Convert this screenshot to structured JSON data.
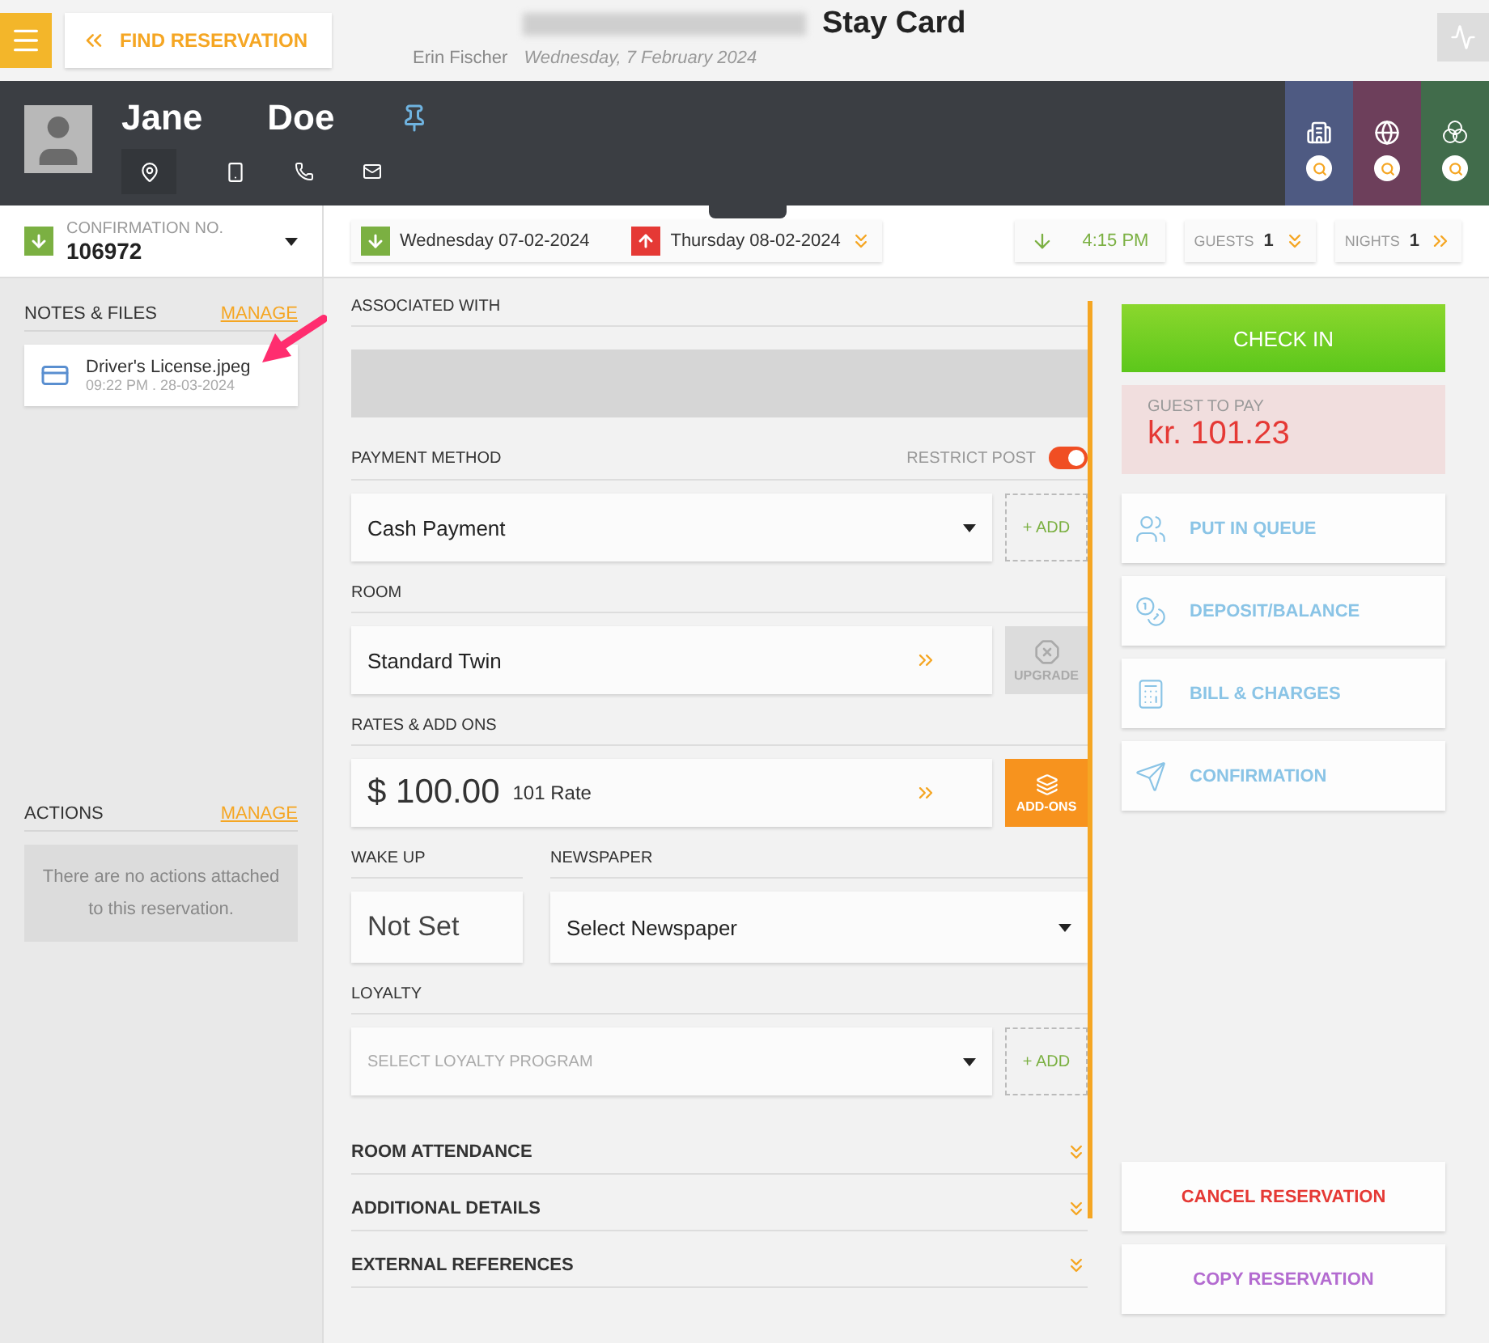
{
  "topbar": {
    "back_label": "FIND RESERVATION",
    "title": "Stay Card",
    "user": "Erin Fischer",
    "date": "Wednesday, 7 February 2024"
  },
  "guest": {
    "first_name": "Jane",
    "last_name": "Doe",
    "tabs": [
      {
        "kind": "building",
        "color": "#4e5a82"
      },
      {
        "kind": "globe",
        "color": "#6d3f5b"
      },
      {
        "kind": "circles",
        "color": "#416c4b"
      }
    ]
  },
  "confirmation": {
    "label": "CONFIRMATION NO.",
    "number": "106972"
  },
  "stay": {
    "arrival": "Wednesday 07-02-2024",
    "departure": "Thursday 08-02-2024",
    "time": "4:15 PM",
    "guests_label": "GUESTS",
    "guests": "1",
    "nights_label": "NIGHTS",
    "nights": "1"
  },
  "notes": {
    "title": "NOTES & FILES",
    "manage": "MANAGE",
    "files": [
      {
        "name": "Driver's License.jpeg",
        "meta": "09:22 PM . 28-03-2024"
      }
    ]
  },
  "actions": {
    "title": "ACTIONS",
    "manage": "MANAGE",
    "empty": "There are no actions attached to this reservation."
  },
  "form": {
    "associated_label": "ASSOCIATED WITH",
    "payment": {
      "label": "PAYMENT METHOD",
      "restrict_label": "RESTRICT POST",
      "restrict_on": true,
      "value": "Cash Payment",
      "add": "+ ADD"
    },
    "room": {
      "label": "ROOM",
      "value": "Standard Twin",
      "upgrade": "UPGRADE",
      "upgrade_disabled": true
    },
    "rates": {
      "label": "RATES & ADD ONS",
      "amount": "$ 100.00",
      "rate": "101 Rate",
      "addons": "ADD-ONS"
    },
    "wake_up": {
      "label": "WAKE UP",
      "value": "Not Set"
    },
    "newspaper": {
      "label": "NEWSPAPER",
      "value": "Select Newspaper"
    },
    "loyalty": {
      "label": "LOYALTY",
      "placeholder": "SELECT LOYALTY PROGRAM",
      "add": "+ ADD"
    },
    "sections": [
      {
        "title": "ROOM ATTENDANCE",
        "expanded": false
      },
      {
        "title": "ADDITIONAL DETAILS",
        "expanded": false
      },
      {
        "title": "EXTERNAL REFERENCES",
        "expanded": false
      }
    ]
  },
  "side": {
    "check_in": "CHECK IN",
    "balance_label": "GUEST TO PAY",
    "balance": "kr. 101.23",
    "buttons": [
      {
        "kind": "queue",
        "label": "PUT IN QUEUE"
      },
      {
        "kind": "deposit",
        "label": "DEPOSIT/BALANCE"
      },
      {
        "kind": "bill",
        "label": "BILL & CHARGES"
      },
      {
        "kind": "confirmation",
        "label": "CONFIRMATION"
      }
    ],
    "cancel": "CANCEL RESERVATION",
    "copy": "COPY RESERVATION"
  }
}
